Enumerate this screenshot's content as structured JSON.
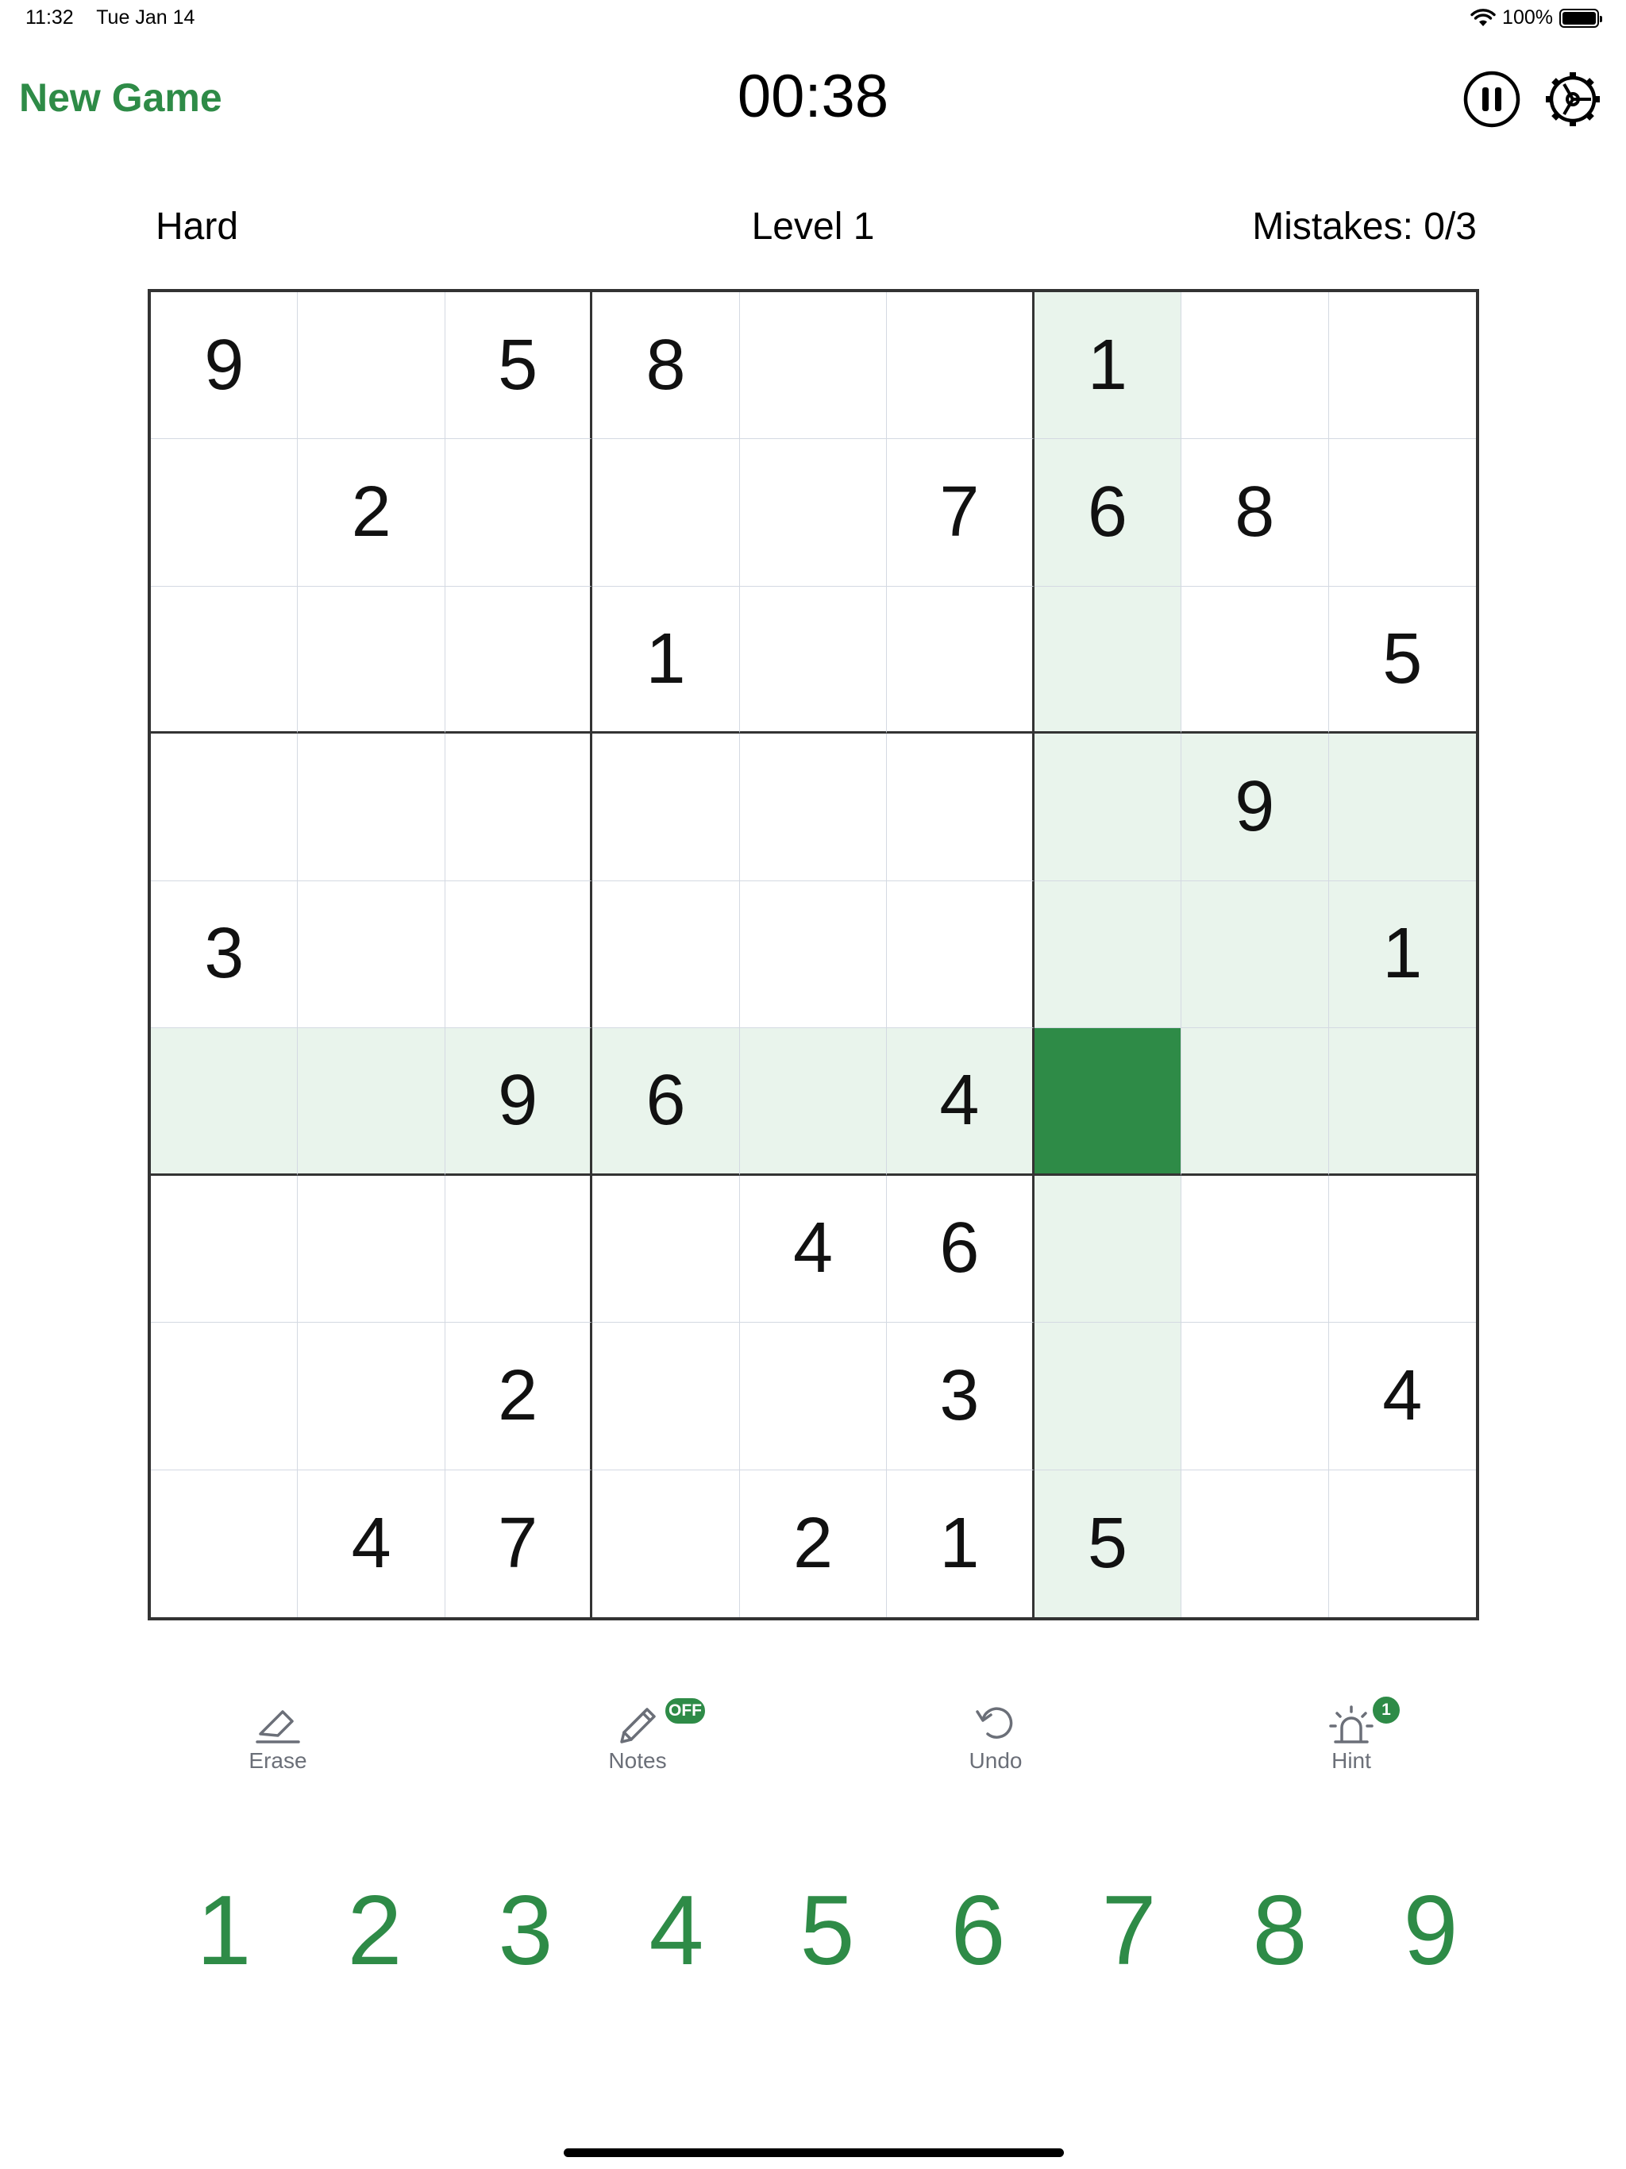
{
  "status_bar": {
    "time": "11:32",
    "date": "Tue Jan 14",
    "battery": "100%"
  },
  "header": {
    "new_game_label": "New Game",
    "timer": "00:38"
  },
  "info": {
    "difficulty": "Hard",
    "level": "Level 1",
    "mistakes": "Mistakes: 0/3"
  },
  "board": {
    "grid": [
      [
        "9",
        "",
        "5",
        "8",
        "",
        "",
        "1",
        "",
        ""
      ],
      [
        "",
        "2",
        "",
        "",
        "",
        "7",
        "6",
        "8",
        ""
      ],
      [
        "",
        "",
        "",
        "1",
        "",
        "",
        "",
        "",
        "5"
      ],
      [
        "",
        "",
        "",
        "",
        "",
        "",
        "",
        "9",
        ""
      ],
      [
        "3",
        "",
        "",
        "",
        "",
        "",
        "",
        "",
        "1"
      ],
      [
        "",
        "",
        "9",
        "6",
        "",
        "4",
        "",
        "",
        ""
      ],
      [
        "",
        "",
        "",
        "",
        "4",
        "6",
        "",
        "",
        ""
      ],
      [
        "",
        "",
        "2",
        "",
        "",
        "3",
        "",
        "",
        "4"
      ],
      [
        "",
        "4",
        "7",
        "",
        "2",
        "1",
        "5",
        "",
        ""
      ]
    ],
    "selected_cell": {
      "row": 6,
      "col": 7
    }
  },
  "tools": {
    "erase_label": "Erase",
    "notes_label": "Notes",
    "notes_badge": "OFF",
    "undo_label": "Undo",
    "hint_label": "Hint",
    "hint_badge": "1"
  },
  "numpad": [
    "1",
    "2",
    "3",
    "4",
    "5",
    "6",
    "7",
    "8",
    "9"
  ],
  "colors": {
    "accent": "#2e8b47",
    "highlight": "#e9f4ec",
    "grid_line": "#d4d9e2",
    "box_line": "#333333"
  }
}
